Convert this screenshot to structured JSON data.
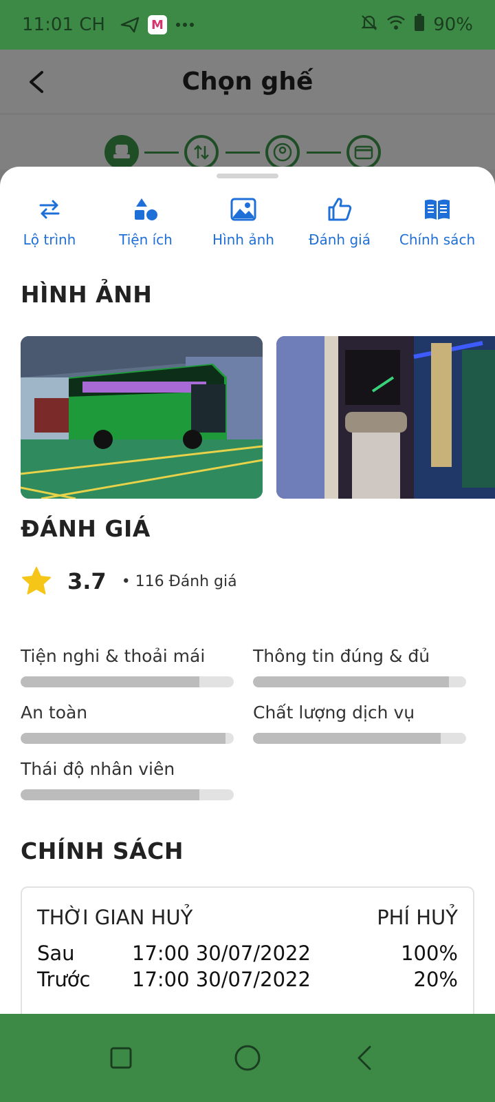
{
  "status_bar": {
    "time": "11:01 CH",
    "battery": "90%"
  },
  "header": {
    "title": "Chọn ghế"
  },
  "tabs": [
    {
      "label": "Lộ trình",
      "icon": "swap-icon"
    },
    {
      "label": "Tiện ích",
      "icon": "shapes-icon"
    },
    {
      "label": "Hình ảnh",
      "icon": "image-icon"
    },
    {
      "label": "Đánh giá",
      "icon": "thumbs-up-icon"
    },
    {
      "label": "Chính sách",
      "icon": "book-icon"
    }
  ],
  "images_section": {
    "title": "HÌNH ẢNH"
  },
  "reviews_section": {
    "title": "ĐÁNH GIÁ",
    "rating": "3.7",
    "count": "• 116 Đánh giá",
    "criteria": [
      {
        "label": "Tiện nghi & thoải mái",
        "fraction": 0.84
      },
      {
        "label": "Thông tin đúng & đủ",
        "fraction": 0.92
      },
      {
        "label": "An toàn",
        "fraction": 0.96
      },
      {
        "label": "Chất lượng dịch vụ",
        "fraction": 0.88
      },
      {
        "label": "Thái độ nhân viên",
        "fraction": 0.84
      }
    ]
  },
  "policy_section": {
    "title": "CHÍNH SÁCH",
    "col_time": "THỜI GIAN HUỶ",
    "col_fee": "PHÍ HUỶ",
    "rows": [
      {
        "when": "Sau",
        "datetime": "17:00 30/07/2022",
        "fee": "100%"
      },
      {
        "when": "Trước",
        "datetime": "17:00 30/07/2022",
        "fee": "20%"
      }
    ]
  },
  "colors": {
    "primary_green": "#3d8a47",
    "tab_blue": "#1f6fd8",
    "star": "#f5c518"
  }
}
